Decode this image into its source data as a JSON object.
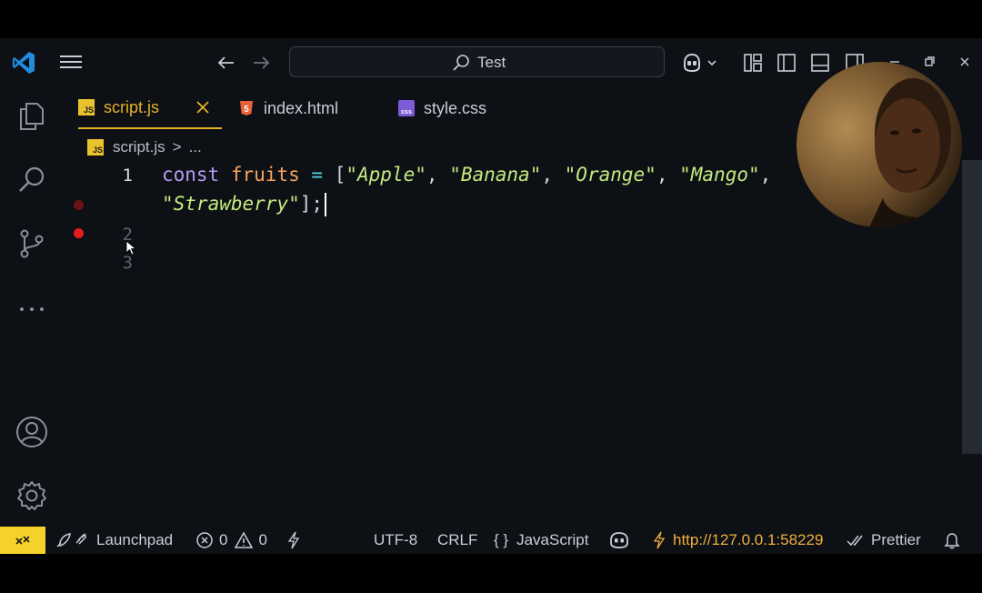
{
  "search": {
    "text": "Test"
  },
  "tabs": [
    {
      "label": "script.js",
      "icon": "JS",
      "icon_color": "#e8c32e",
      "active": true
    },
    {
      "label": "index.html",
      "icon": "5",
      "icon_color": "#e8613a",
      "active": false
    },
    {
      "label": "style.css",
      "icon": "css",
      "icon_color": "#7e5bd6",
      "active": false
    }
  ],
  "breadcrumb": {
    "file": "script.js",
    "sep": ">",
    "more": "..."
  },
  "editor": {
    "line_numbers": [
      "1",
      "2",
      "3"
    ],
    "code": {
      "kw": "const",
      "var": "fruits",
      "op": "=",
      "open": "[",
      "s1": "\"Apple\"",
      "s2": "\"Banana\"",
      "s3": "\"Orange\"",
      "s4": "\"Mango\"",
      "s5": "\"Strawberry\"",
      "comma": ",",
      "close": "];"
    }
  },
  "status": {
    "launchpad": "Launchpad",
    "errors": "0",
    "warnings": "0",
    "encoding": "UTF-8",
    "eol": "CRLF",
    "language_brace": "{ }",
    "language": "JavaScript",
    "live_server": "http://127.0.0.1:58229",
    "prettier": "Prettier"
  },
  "colors": {
    "accent_tab": "#e5b124",
    "remote_bg": "#f4d22a",
    "breakpoint": "#e51c1c",
    "live_server": "#f0ae3e"
  }
}
